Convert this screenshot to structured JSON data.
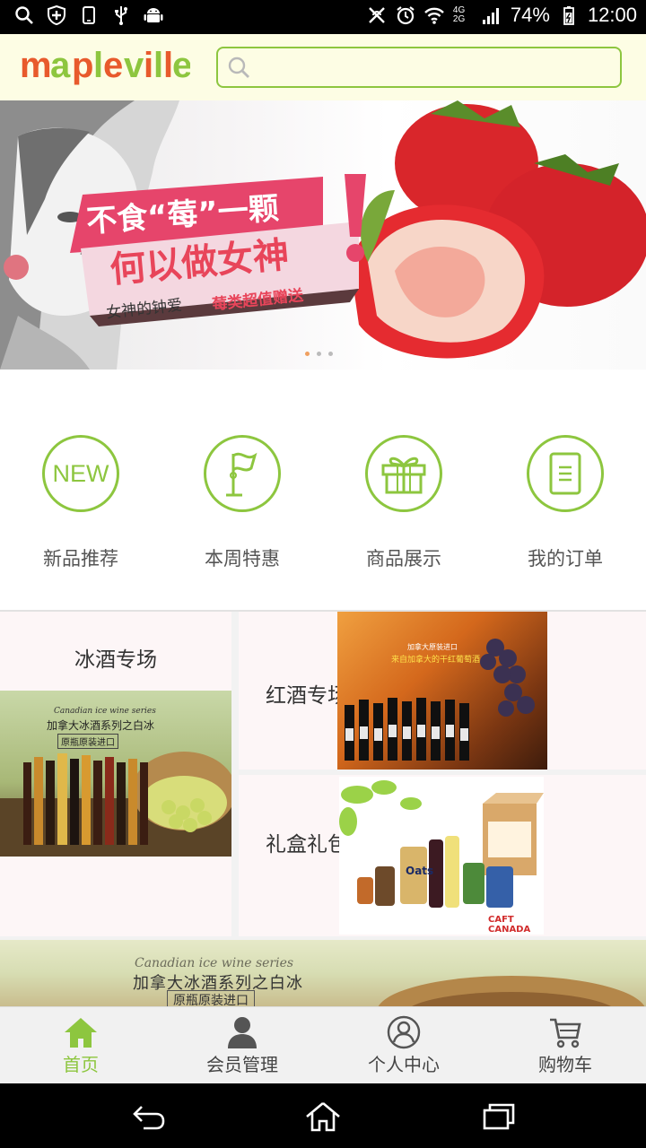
{
  "status_bar": {
    "battery": "74%",
    "time": "12:00",
    "network": "4G 2G"
  },
  "header": {
    "logo_text": "mapleville",
    "search_placeholder": ""
  },
  "banner": {
    "line1": "不食“莓”一颗",
    "line2": "何以做女神",
    "line3_left": "女神的钟爱",
    "line3_right": "莓类超值赠送",
    "slides": 3,
    "active_slide": 1
  },
  "categories": [
    {
      "label": "新品推荐",
      "icon": "new-icon",
      "icon_text": "NEW"
    },
    {
      "label": "本周特惠",
      "icon": "flag-icon"
    },
    {
      "label": "商品展示",
      "icon": "gift-icon"
    },
    {
      "label": "我的订单",
      "icon": "order-icon"
    }
  ],
  "promo": {
    "left_title": "冰酒专场",
    "left_img_line1": "Canadian ice wine series",
    "left_img_line2": "加拿大冰酒系列之白冰",
    "left_img_line3": "原瓶原装进口",
    "red_wine_label": "红酒专场",
    "red_wine_img_line1": "加拿大原装进口",
    "red_wine_img_line2": "来自加拿大的干红葡萄酒",
    "gift_label": "礼盒礼包",
    "gift_brand": "CAFT CANADA",
    "gift_can": "Oats"
  },
  "strip": {
    "line1": "Canadian ice wine series",
    "line2": "加拿大冰酒系列之白冰",
    "line3": "原瓶原装进口"
  },
  "tabs": [
    {
      "label": "首页",
      "icon": "home-icon",
      "active": true
    },
    {
      "label": "会员管理",
      "icon": "member-icon",
      "active": false
    },
    {
      "label": "个人中心",
      "icon": "profile-icon",
      "active": false
    },
    {
      "label": "购物车",
      "icon": "cart-icon",
      "active": false
    }
  ],
  "colors": {
    "accent": "#8dc63f",
    "header_bg": "#fdfde4",
    "banner_red": "#e8455a"
  }
}
